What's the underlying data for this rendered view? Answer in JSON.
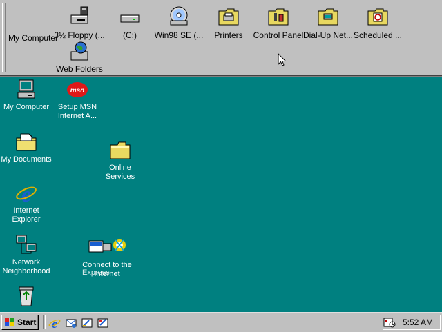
{
  "toolbar": {
    "title": "My Computer",
    "items": [
      {
        "label": "3½ Floppy (...",
        "icon": "floppy-drive-icon"
      },
      {
        "label": "(C:)",
        "icon": "hard-drive-icon"
      },
      {
        "label": "Win98 SE (...",
        "icon": "cd-drive-icon"
      },
      {
        "label": "Printers",
        "icon": "printers-folder-icon"
      },
      {
        "label": "Control Panel",
        "icon": "control-panel-folder-icon"
      },
      {
        "label": "Dial-Up Net...",
        "icon": "dial-up-networking-folder-icon"
      },
      {
        "label": "Scheduled ...",
        "icon": "scheduled-tasks-folder-icon"
      },
      {
        "label": "Web Folders",
        "icon": "web-folders-icon"
      }
    ]
  },
  "desktop": {
    "my_computer": "My Computer",
    "setup_msn_1": "Setup MSN",
    "setup_msn_2": "Internet A...",
    "my_documents": "My Documents",
    "online_services_1": "Online",
    "online_services_2": "Services",
    "internet_explorer_1": "Internet",
    "internet_explorer_2": "Explorer",
    "network_neighborhood_1": "Network",
    "network_neighborhood_2": "Neighborhood",
    "connect_1": "Connect to the",
    "connect_2": "Internet",
    "connect_overlap": "Express",
    "msn_logo": "msn"
  },
  "taskbar": {
    "start_label": "Start",
    "clock": "5:52 AM"
  },
  "colors": {
    "desktop": "#008080",
    "chrome": "#c0c0c0",
    "title_blue": "#000080"
  }
}
